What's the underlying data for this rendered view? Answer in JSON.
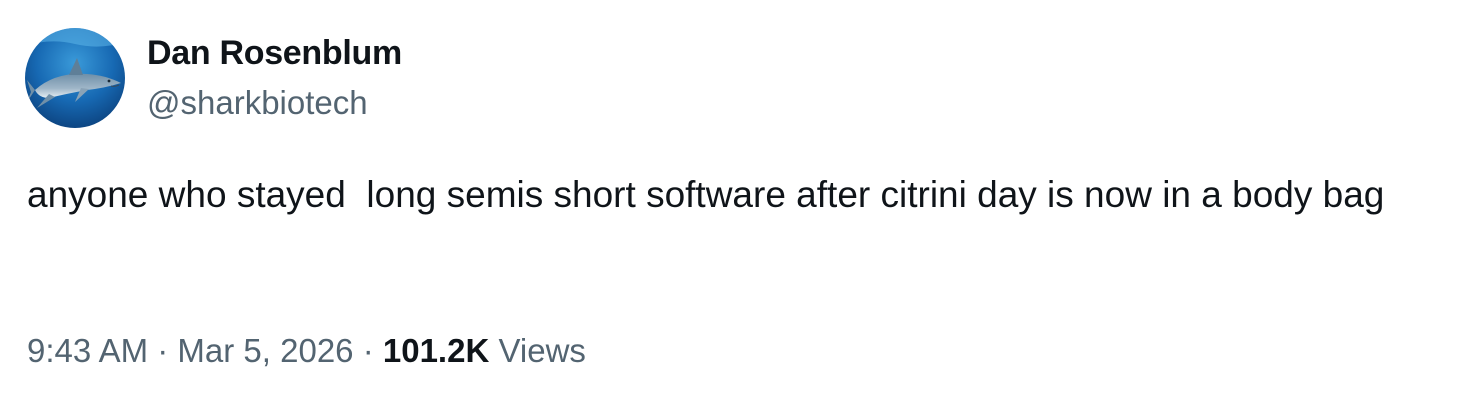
{
  "author": {
    "display_name": "Dan Rosenblum",
    "handle": "@sharkbiotech",
    "avatar_icon": "shark-avatar-icon"
  },
  "tweet": {
    "text": "anyone who stayed  long semis short software after citrini day is now in a body bag"
  },
  "meta": {
    "time": "9:43 AM",
    "separator": "·",
    "date": "Mar 5, 2026",
    "views_count": "101.2K",
    "views_label": "Views"
  },
  "colors": {
    "text_primary": "#0f1419",
    "text_secondary": "#536471",
    "background": "#ffffff"
  }
}
